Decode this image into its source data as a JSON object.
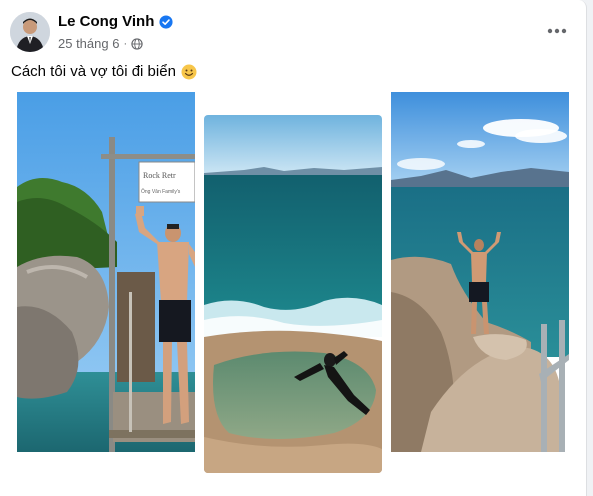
{
  "post": {
    "author": "Le Cong Vinh",
    "verified": true,
    "date": "25 tháng 6",
    "dot": "·",
    "audience_icon": "globe-icon",
    "more_icon": "more-options-icon",
    "caption": "Cách tôi và vợ tôi đi biển",
    "caption_emoji": "smiling-face-emoji"
  },
  "photos": [
    {
      "name": "photo-rock-pier",
      "sign_lines": [
        "Rock Retr",
        "Ông Vân Family's"
      ]
    },
    {
      "name": "photo-sea-water"
    },
    {
      "name": "photo-rock-ocean"
    }
  ],
  "colors": {
    "name": "#050505",
    "meta": "#65676b",
    "verified": "#1877f2",
    "background": "#f0f2f5",
    "card": "#ffffff"
  }
}
